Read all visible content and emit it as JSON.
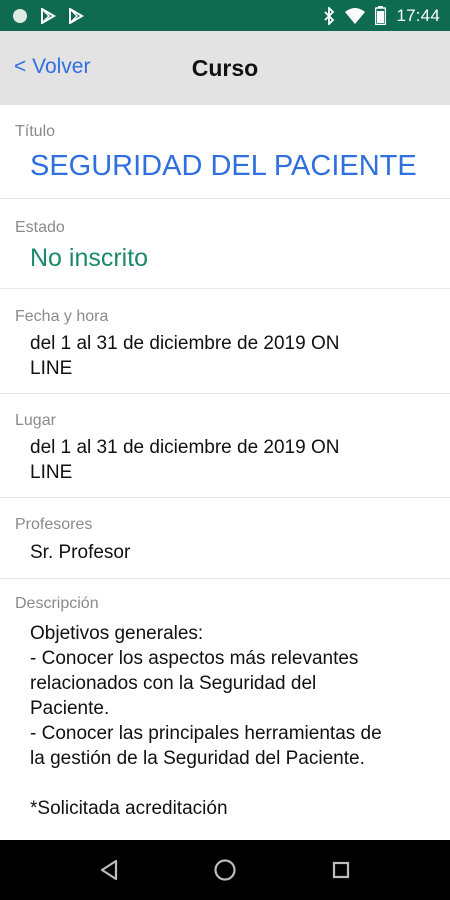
{
  "status_bar": {
    "time": "17:44",
    "left_icons": [
      "circle-notification-icon",
      "play-store-icon",
      "play-store-icon"
    ],
    "right_icons": [
      "bluetooth-icon",
      "wifi-icon",
      "battery-icon"
    ]
  },
  "nav": {
    "back_label": "< Volver",
    "title": "Curso"
  },
  "fields": {
    "titulo": {
      "label": "Título",
      "value": "SEGURIDAD DEL PACIENTE"
    },
    "estado": {
      "label": "Estado",
      "value": "No inscrito"
    },
    "fecha": {
      "label": "Fecha y hora",
      "value": "del 1 al 31 de diciembre de 2019 ON\nLINE"
    },
    "lugar": {
      "label": "Lugar",
      "value": "del 1 al 31 de diciembre de 2019 ON\nLINE"
    },
    "profesores": {
      "label": "Profesores",
      "value": "Sr. Profesor"
    },
    "descripcion": {
      "label": "Descripción",
      "value": "Objetivos generales:\n- Conocer los aspectos más relevantes\nrelacionados con la Seguridad del\nPaciente.\n- Conocer las principales herramientas de\nla gestión de la Seguridad del Paciente.\n\n*Solicitada acreditación"
    }
  },
  "colors": {
    "status_bar": "#0e6b4f",
    "nav_bar": "#e3e3e3",
    "link_blue": "#2f6fe0",
    "status_green": "#1b8a6b"
  },
  "bottom_nav": [
    "back-triangle-icon",
    "home-circle-icon",
    "recents-square-icon"
  ]
}
